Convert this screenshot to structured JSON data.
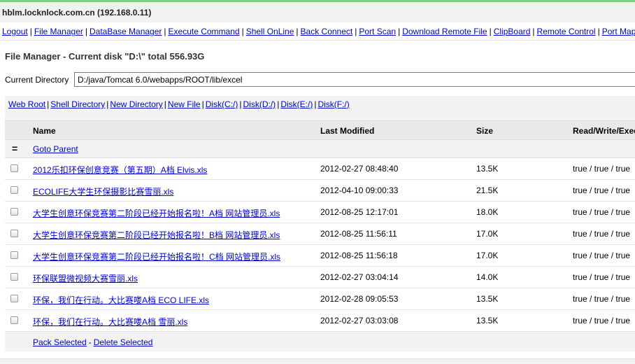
{
  "header": {
    "host": "hblm.locknlock.com.cn (192.168.0.11)"
  },
  "menu": [
    "Logout",
    "File Manager",
    "DataBase Manager",
    "Execute Command",
    "Shell OnLine",
    "Back Connect",
    "Port Scan",
    "Download Remote File",
    "ClipBoard",
    "Remote Control",
    "Port Map"
  ],
  "file_manager": {
    "title": "File Manager - Current disk \"D:\\\" total 556.93G",
    "current_dir_label": "Current Directory",
    "current_dir_value": "D:/java/Tomcat 6.0/webapps/ROOT/lib/excel"
  },
  "disk_nav": [
    "Web Root",
    "Shell Directory",
    "New Directory",
    "New File",
    "Disk(C:/)",
    "Disk(D:/)",
    "Disk(E:/)",
    "Disk(F:/)"
  ],
  "table": {
    "columns": [
      "Name",
      "Last Modified",
      "Size",
      "Read/Write/Execute"
    ],
    "parent_symbol": "=",
    "goto_parent": "Goto Parent",
    "rows": [
      {
        "name": "2012乐扣环保创意竞赛（第五期）A档 Elvis.xls",
        "modified": "2012-02-27 08:48:40",
        "size": "13.5K",
        "rwe": "true / true / true"
      },
      {
        "name": "ECOLIFE大学生环保摄影比赛雪丽.xls",
        "modified": "2012-04-10 09:00:33",
        "size": "21.5K",
        "rwe": "true / true / true"
      },
      {
        "name": "大学生创意环保竞赛第二阶段已经开始报名啦！A档 网站管理员.xls",
        "modified": "2012-08-25 12:17:01",
        "size": "18.0K",
        "rwe": "true / true / true"
      },
      {
        "name": "大学生创意环保竞赛第二阶段已经开始报名啦！B档 网站管理员.xls",
        "modified": "2012-08-25 11:56:11",
        "size": "17.0K",
        "rwe": "true / true / true"
      },
      {
        "name": "大学生创意环保竞赛第二阶段已经开始报名啦！C档 网站管理员.xls",
        "modified": "2012-08-25 11:56:18",
        "size": "17.0K",
        "rwe": "true / true / true"
      },
      {
        "name": "环保联盟微视频大赛雪丽.xls",
        "modified": "2012-02-27 03:04:14",
        "size": "14.0K",
        "rwe": "true / true / true"
      },
      {
        "name": "环保，我们在行动。大比赛喽A档 ECO LIFE.xls",
        "modified": "2012-02-28 09:05:53",
        "size": "13.5K",
        "rwe": "true / true / true"
      },
      {
        "name": "环保，我们在行动。大比赛喽A档 雪丽.xls",
        "modified": "2012-02-27 03:03:08",
        "size": "13.5K",
        "rwe": "true / true / true"
      }
    ]
  },
  "actions": {
    "pack": "Pack Selected",
    "separator": "-",
    "delete": "Delete Selected"
  }
}
